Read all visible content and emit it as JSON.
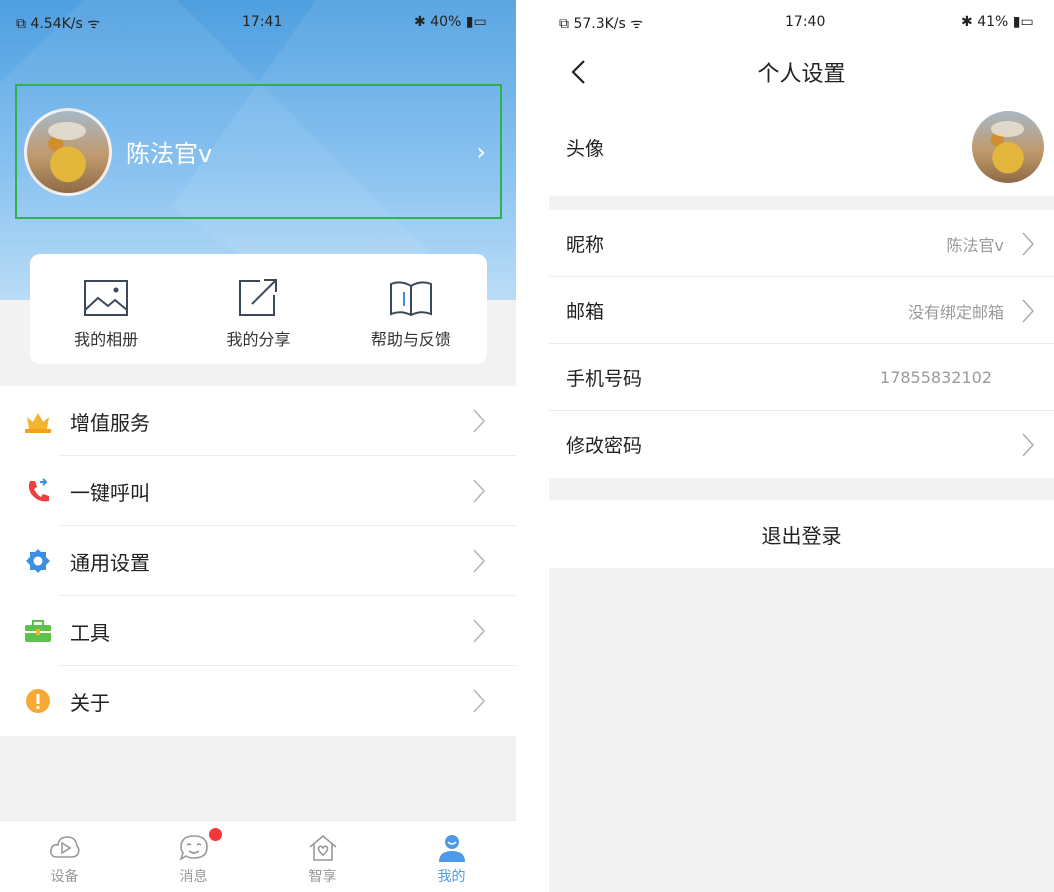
{
  "left": {
    "status": {
      "net": "4.54K/s",
      "time": "17:41",
      "battery": "40%"
    },
    "profile": {
      "name": "陈法官v"
    },
    "quick_actions": [
      {
        "label": "我的相册",
        "icon": "album-icon"
      },
      {
        "label": "我的分享",
        "icon": "share-icon"
      },
      {
        "label": "帮助与反馈",
        "icon": "help-book-icon"
      }
    ],
    "menu": [
      {
        "label": "增值服务",
        "icon": "crown-icon",
        "color": "#f5b42f"
      },
      {
        "label": "一键呼叫",
        "icon": "phone-call-icon",
        "color": "#ee4040"
      },
      {
        "label": "通用设置",
        "icon": "gear-icon",
        "color": "#3d8fe6"
      },
      {
        "label": "工具",
        "icon": "toolbox-icon",
        "color": "#5dc24a"
      },
      {
        "label": "关于",
        "icon": "info-icon",
        "color": "#f6a934"
      }
    ],
    "tabs": [
      {
        "label": "设备",
        "icon": "device-play-icon"
      },
      {
        "label": "消息",
        "icon": "message-icon",
        "badge": true
      },
      {
        "label": "智享",
        "icon": "smart-home-icon"
      },
      {
        "label": "我的",
        "icon": "profile-icon",
        "active": true
      }
    ],
    "accent": "#4d9ae8"
  },
  "right": {
    "status": {
      "net": "57.3K/s",
      "time": "17:40",
      "battery": "41%"
    },
    "title": "个人设置",
    "avatar_label": "头像",
    "rows": [
      {
        "label": "昵称",
        "value": "陈法官v"
      },
      {
        "label": "邮箱",
        "value": "没有绑定邮箱"
      },
      {
        "label": "手机号码",
        "value": "17855832102"
      },
      {
        "label": "修改密码",
        "value": ""
      }
    ],
    "logout": "退出登录"
  }
}
